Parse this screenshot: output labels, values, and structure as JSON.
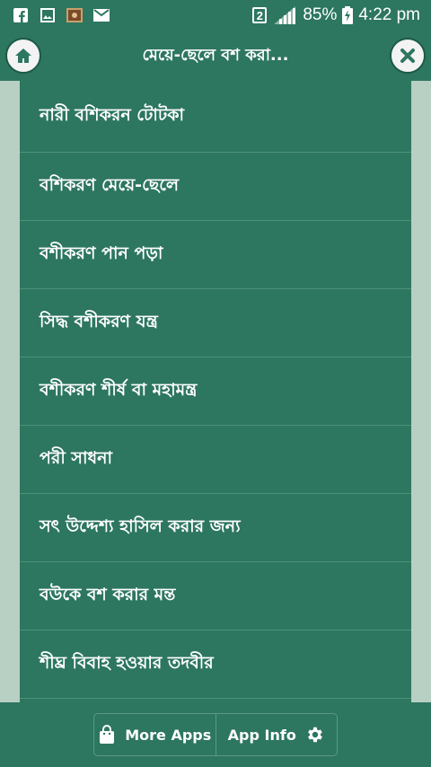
{
  "status_bar": {
    "sim": "2",
    "battery": "85%",
    "time": "4:22 pm"
  },
  "app_bar": {
    "title": "মেয়ে-ছেলে বশ করা..."
  },
  "list": {
    "items": [
      "নারী বশিকরন টোটকা",
      "বশিকরণ মেয়ে-ছেলে",
      "বশীকরণ পান পড়া",
      "সিদ্ধ বশীকরণ যন্ত্র",
      "বশীকরণ শীর্ষ বা মহামন্ত্র",
      "পরী সাধনা",
      "সৎ উদ্দেশ্য হাসিল করার জন্য",
      "বউকে বশ করার মন্ত",
      "শীঘ্র বিবাহ হওয়ার তদবীর"
    ]
  },
  "bottom_bar": {
    "more_apps": "More Apps",
    "app_info": "App Info"
  },
  "colors": {
    "primary": "#2d7660",
    "divider": "#4f917b",
    "side": "#b8cfc3"
  },
  "icons": [
    "facebook-icon",
    "gallery-icon",
    "photo-app-icon",
    "mail-icon",
    "signal-icon",
    "battery-icon",
    "home-icon",
    "close-icon",
    "shopping-bag-icon",
    "gear-icon"
  ]
}
